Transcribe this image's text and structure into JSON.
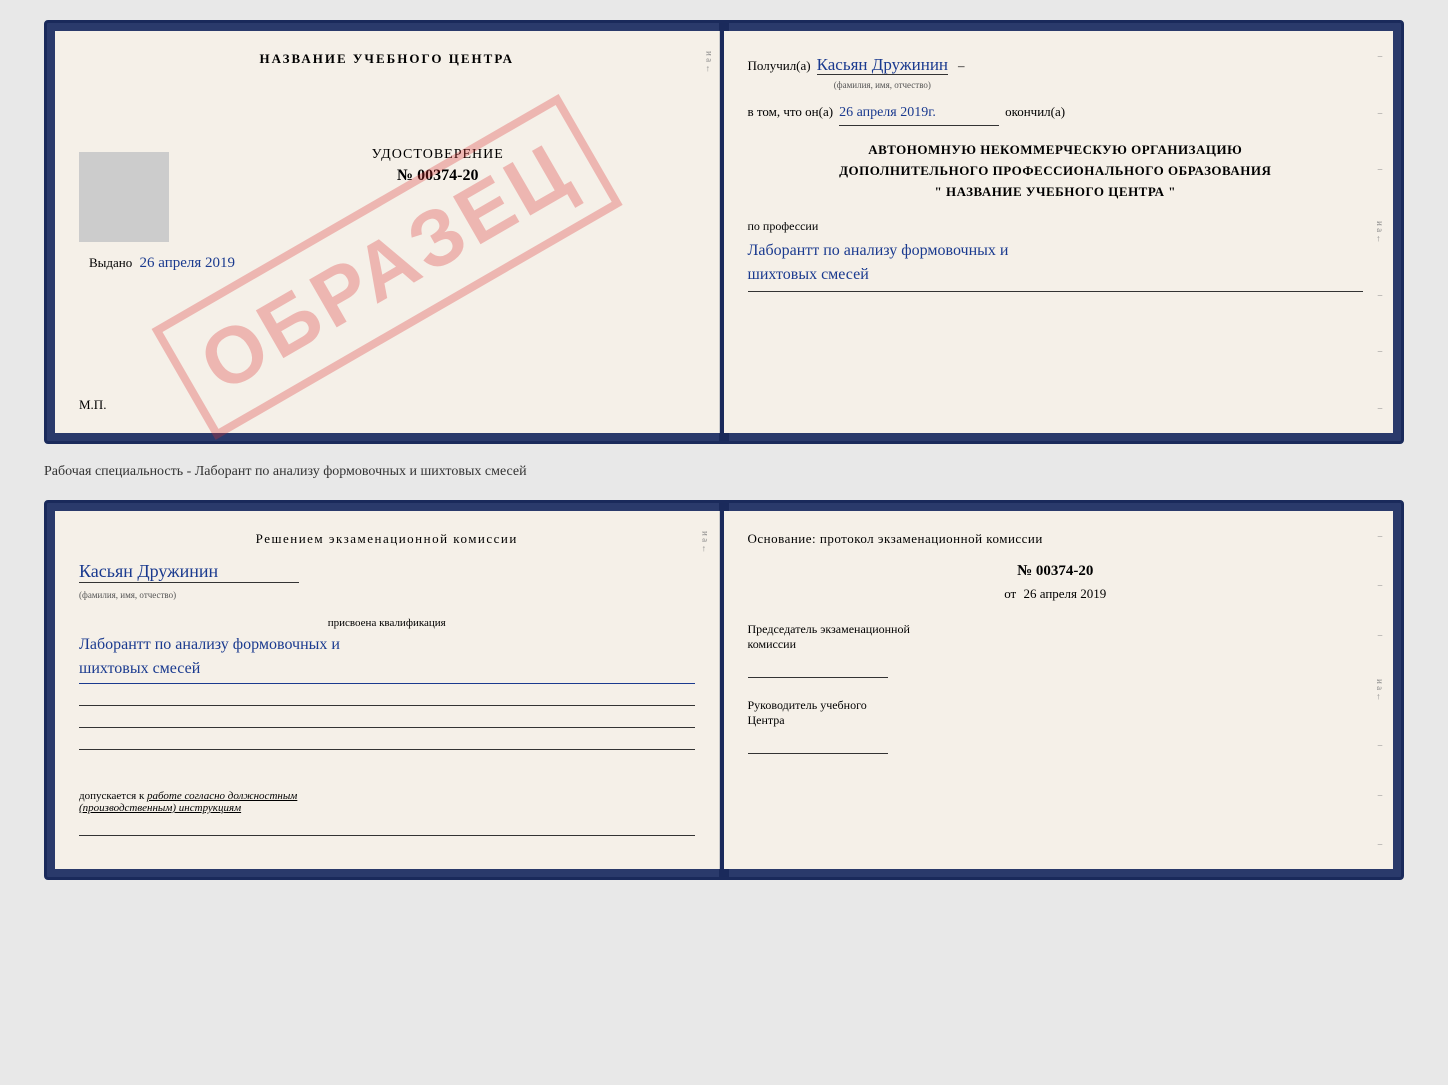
{
  "page": {
    "background": "#e8e8e8"
  },
  "top_book": {
    "left_page": {
      "title": "НАЗВАНИЕ УЧЕБНОГО ЦЕНТРА",
      "watermark": "ОБРАЗЕЦ",
      "udost_title": "УДОСТОВЕРЕНИЕ",
      "udost_number": "№ 00374-20",
      "vydano_label": "Выдано",
      "vydano_date": "26 апреля 2019",
      "mp_label": "М.П."
    },
    "right_page": {
      "poluchil_label": "Получил(а)",
      "poluchil_name": "Касьян Дружинин",
      "name_hint": "(фамилия, имя, отчество)",
      "vtom_label": "в том, что он(а)",
      "vtom_date": "26 апреля 2019г.",
      "okonchil_label": "окончил(а)",
      "avtonom_line1": "АВТОНОМНУЮ НЕКОММЕРЧЕСКУЮ ОРГАНИЗАЦИЮ",
      "avtonom_line2": "ДОПОЛНИТЕЛЬНОГО ПРОФЕССИОНАЛЬНОГО ОБРАЗОВАНИЯ",
      "avtonom_line3": "\"   НАЗВАНИЕ УЧЕБНОГО ЦЕНТРА   \"",
      "po_professii_label": "по профессии",
      "professiya": "Лаборантт по анализу формовочных и",
      "professiya2": "шихтовых смесей"
    }
  },
  "separator": {
    "text": "Рабочая специальность - Лаборант по анализу формовочных и шихтовых смесей"
  },
  "bottom_book": {
    "left_page": {
      "resheniem_title": "Решением экзаменационной комиссии",
      "name_handwritten": "Касьян Дружинин",
      "familiya_hint": "(фамилия, имя, отчество)",
      "prisvoena_label": "присвоена квалификация",
      "kvali_line1": "Лаборантт по анализу формовочных и",
      "kvali_line2": "шихтовых смесей",
      "dopuskaetsya_label": "допускается к",
      "dopusk_text": "работе согласно должностным",
      "dopusk_text2": "(производственным) инструкциям"
    },
    "right_page": {
      "osnovanie_label": "Основание: протокол экзаменационной комиссии",
      "protokol_number": "№ 00374-20",
      "ot_label": "от",
      "ot_date": "26 апреля 2019",
      "predsedatel_label": "Председатель экзаменационной",
      "predsedatel_label2": "комиссии",
      "rukovoditel_label": "Руководитель учебного",
      "rukovoditel_label2": "Центра"
    }
  }
}
